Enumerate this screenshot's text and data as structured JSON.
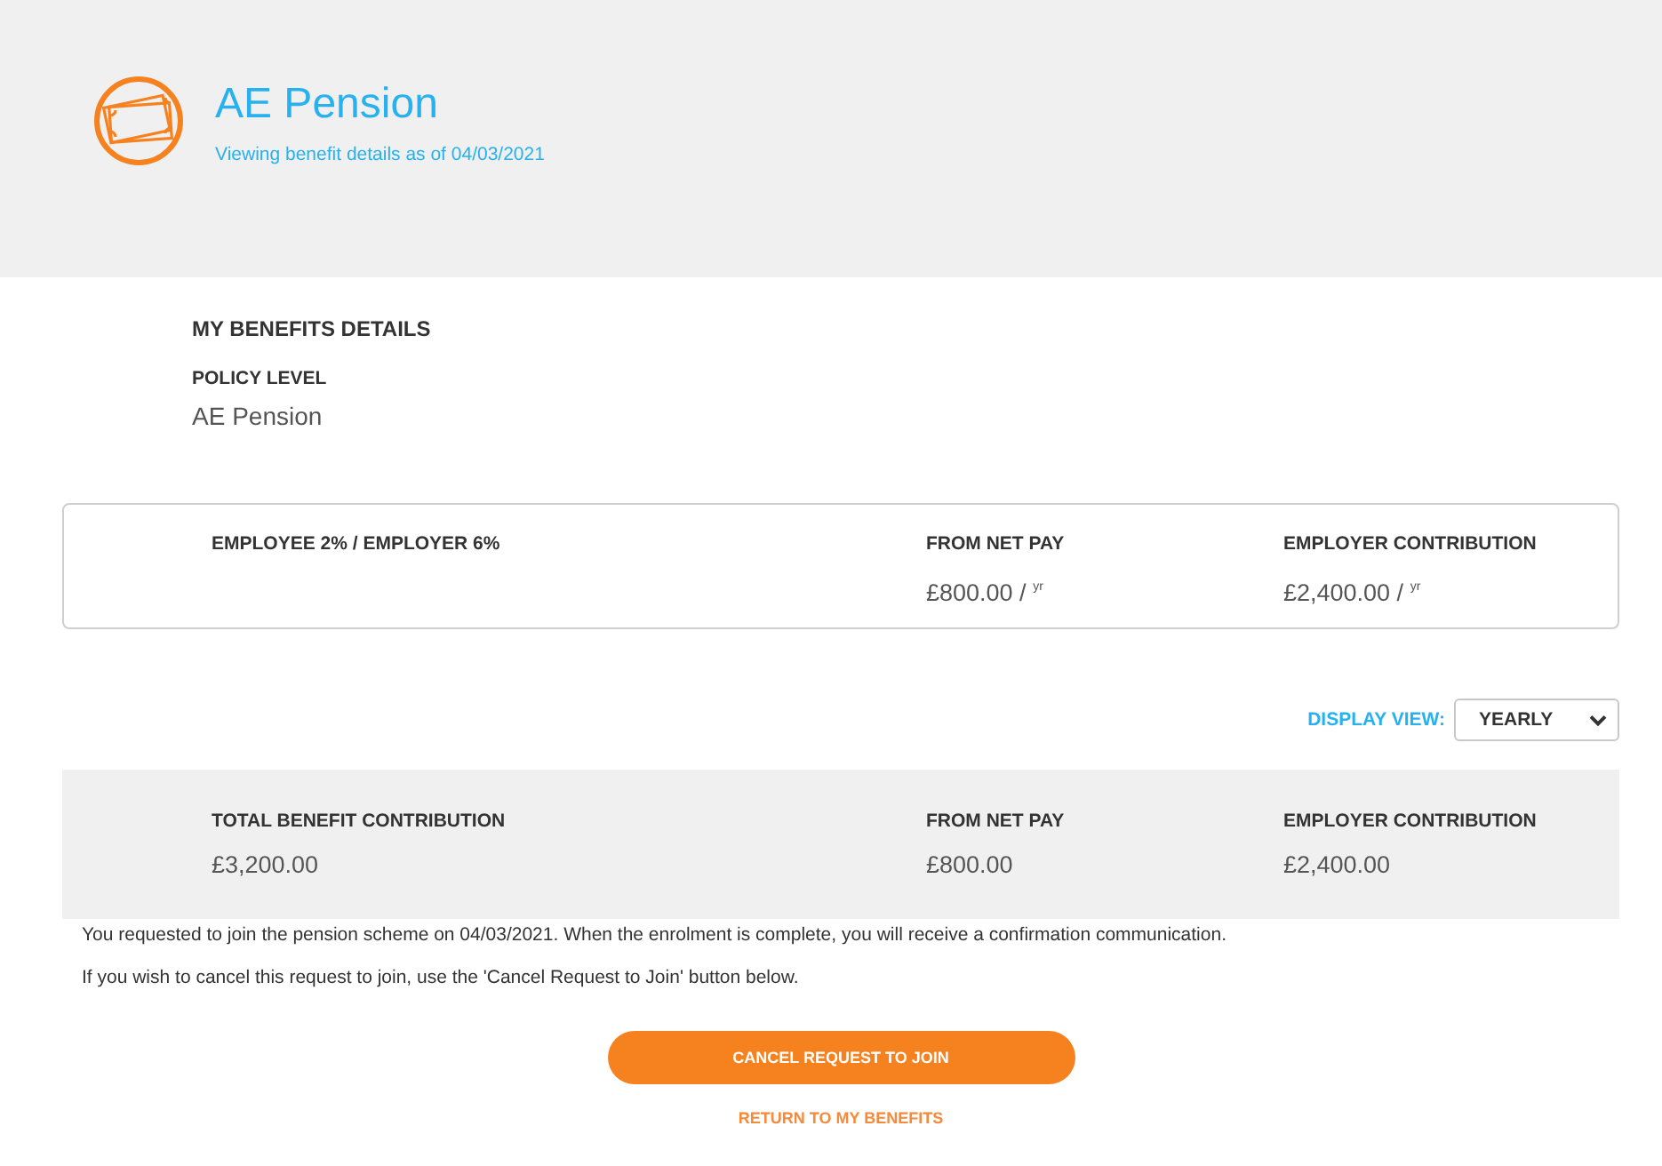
{
  "header": {
    "title": "AE Pension",
    "subtitle": "Viewing benefit details as of 04/03/2021"
  },
  "details": {
    "heading": "MY BENEFITS DETAILS",
    "policy_level_label": "POLICY LEVEL",
    "policy_level": "AE Pension"
  },
  "plan_card": {
    "name": "EMPLOYEE 2% / EMPLOYER 6%",
    "columns": [
      {
        "label": "FROM NET PAY",
        "value": "£800.00 / $^{yr}$"
      },
      {
        "label": "EMPLOYER CONTRIBUTION",
        "value": "£2,400.00 / $^{yr}$"
      }
    ]
  },
  "display_view": {
    "label": "DISPLAY VIEW:",
    "value": "YEARLY"
  },
  "totals": {
    "columns": [
      {
        "label": "TOTAL BENEFIT CONTRIBUTION",
        "value": "£3,200.00"
      },
      {
        "label": "FROM NET PAY",
        "value": "£800.00"
      },
      {
        "label": "EMPLOYER CONTRIBUTION",
        "value": "£2,400.00"
      }
    ]
  },
  "messages": [
    "You requested to join the pension scheme on 04/03/2021. When the enrolment is complete, you will receive a confirmation communication.",
    "If you wish to cancel this request to join, use the 'Cancel Request to Join' button below."
  ],
  "buttons": [
    {
      "label": "CANCEL REQUEST TO JOIN",
      "kind": "primary"
    },
    {
      "label": "RETURN TO MY BENEFITS",
      "kind": "link"
    }
  ]
}
